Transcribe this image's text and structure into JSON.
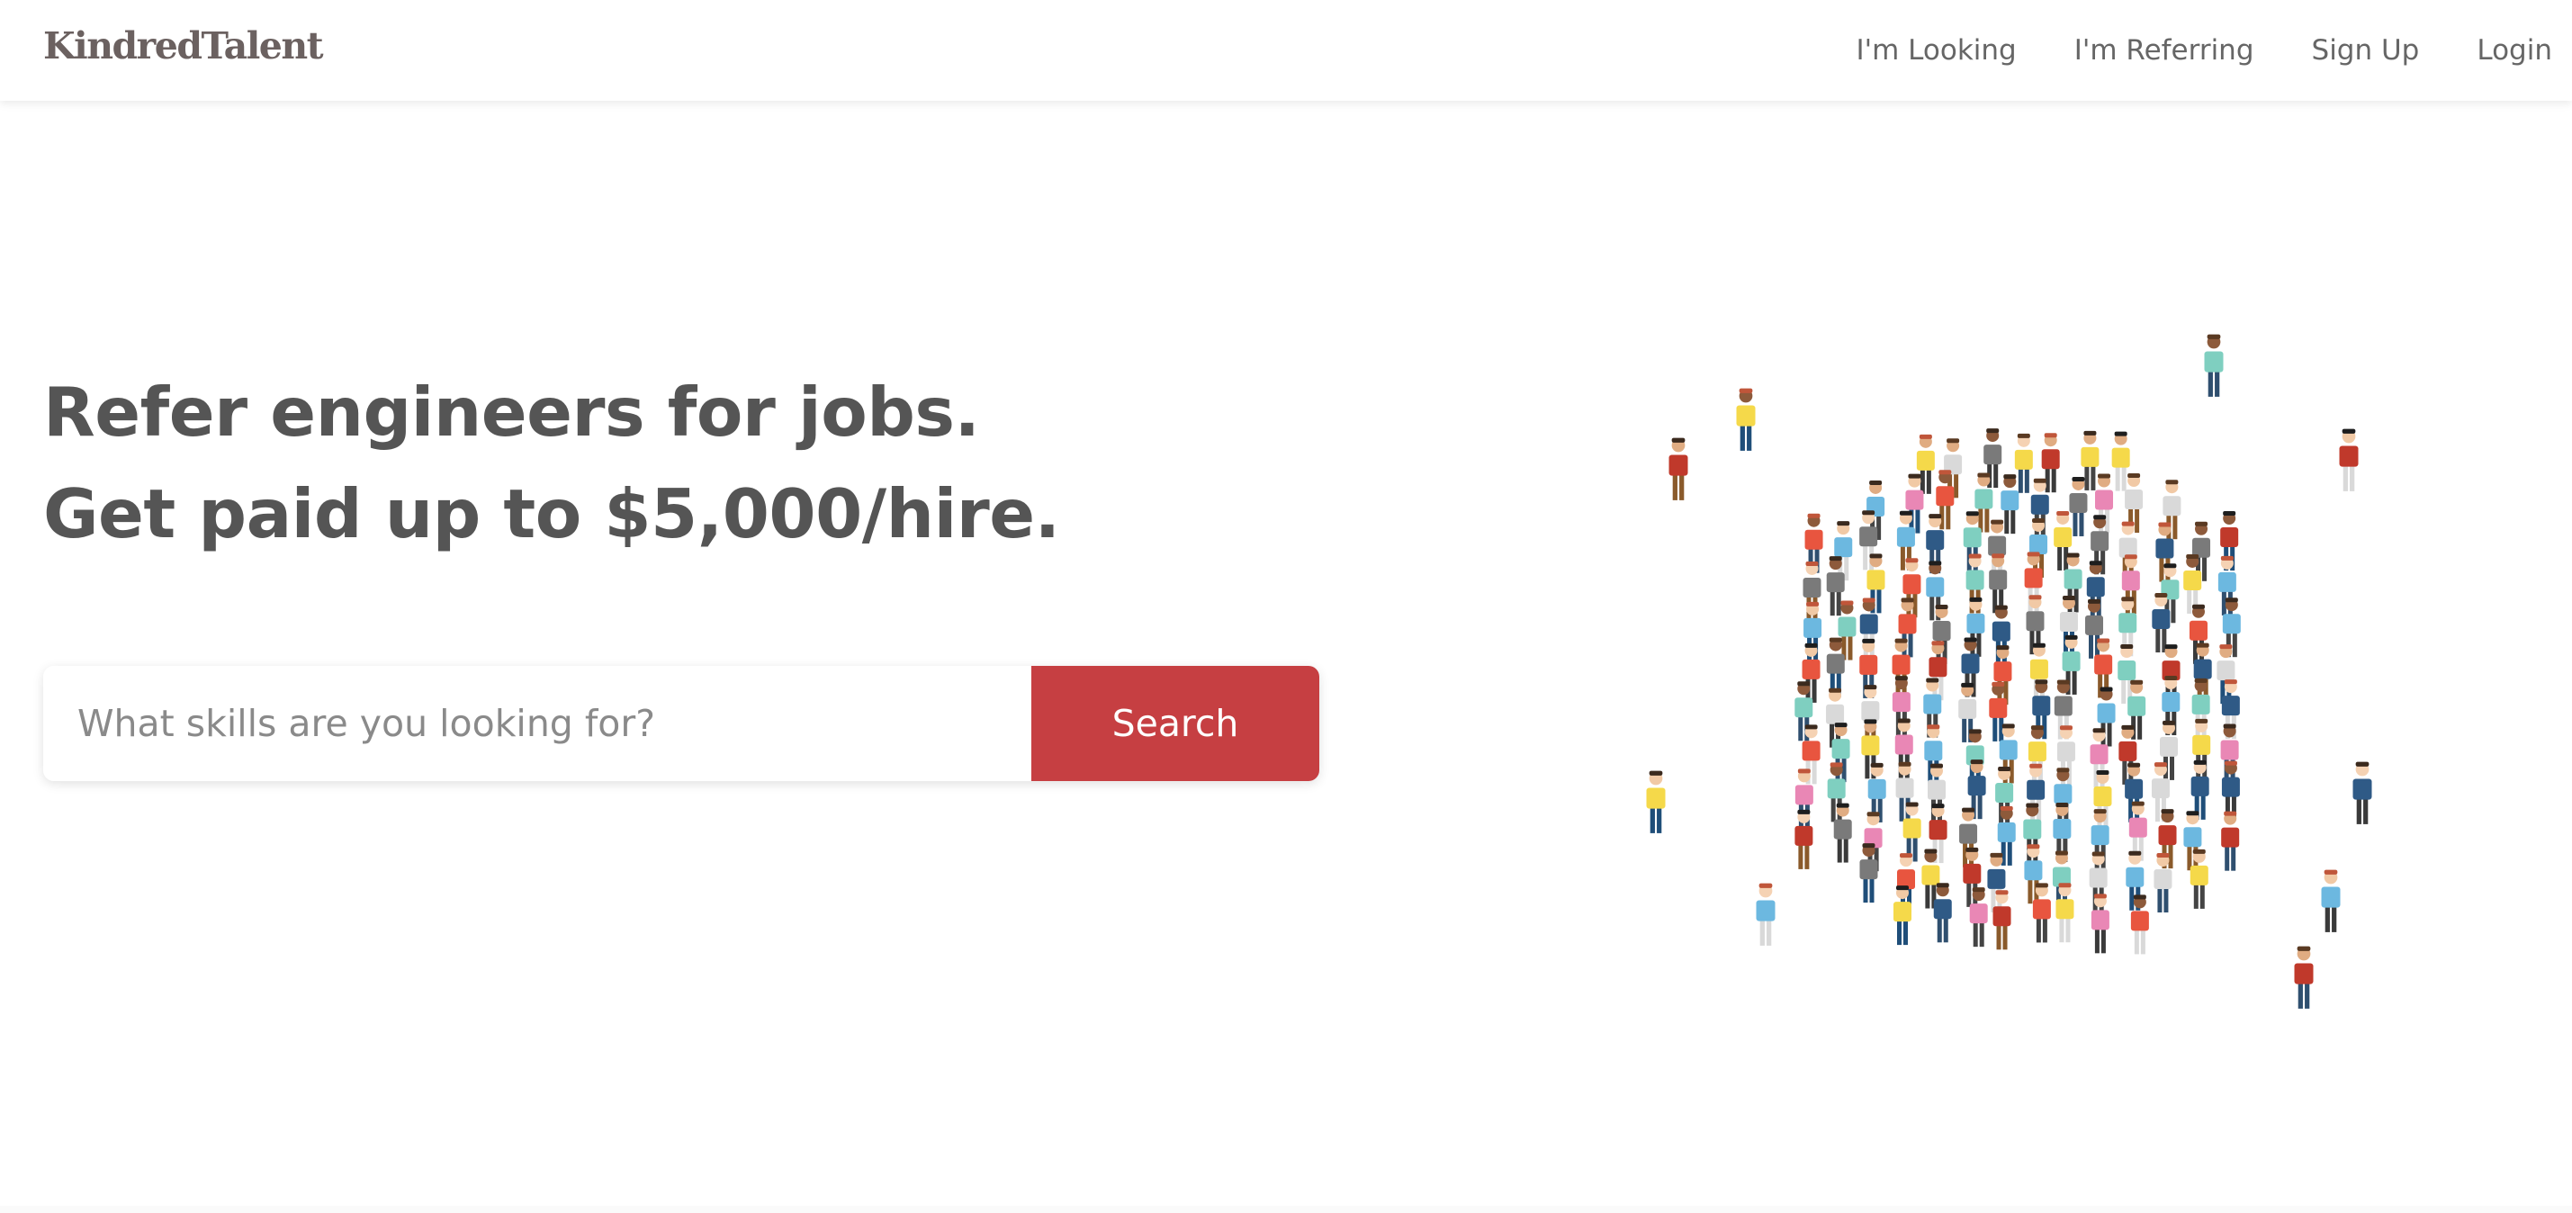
{
  "brand": {
    "name": "KindredTalent"
  },
  "nav": {
    "items": [
      {
        "label": "I'm Looking"
      },
      {
        "label": "I'm Referring"
      },
      {
        "label": "Sign Up"
      },
      {
        "label": "Login"
      }
    ]
  },
  "hero": {
    "headline_line1": "Refer engineers for jobs.",
    "headline_line2": "Get paid up to $5,000/hire."
  },
  "search": {
    "placeholder": "What skills are you looking for?",
    "value": "",
    "button_label": "Search"
  },
  "illustration": {
    "icon": "crowd-of-people-illustration",
    "shirt_colors": [
      "#e8553f",
      "#f5d94a",
      "#6cb8e0",
      "#7fcfc0",
      "#7a7a7a",
      "#d9d9d9",
      "#e987b5",
      "#2f5a86",
      "#c0392b"
    ]
  },
  "colors": {
    "accent": "#c63f42",
    "text": "#555555",
    "nav_text": "#666666",
    "brand_text": "#6b6160"
  }
}
